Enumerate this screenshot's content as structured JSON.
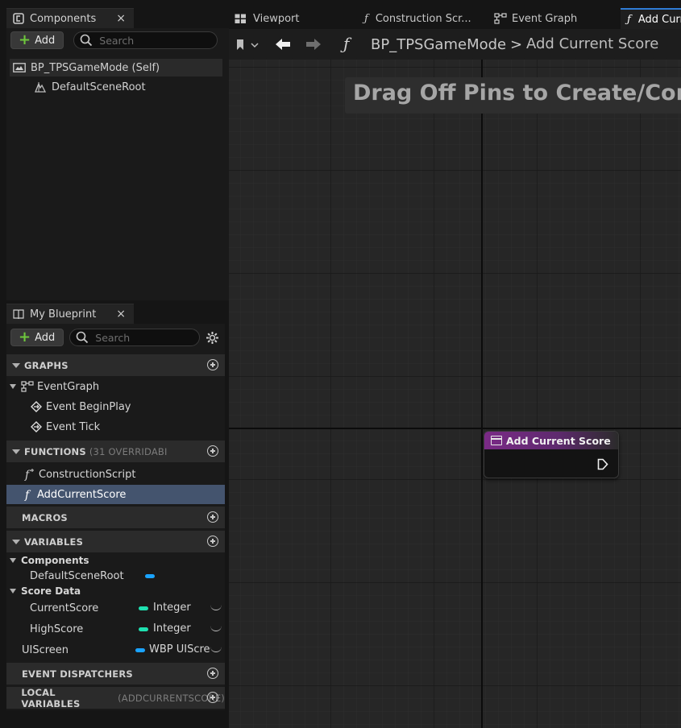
{
  "components_panel": {
    "tab_title": "Components",
    "close": "×",
    "add_label": "Add",
    "search_placeholder": "Search",
    "tree": [
      {
        "label": "BP_TPSGameMode (Self)"
      },
      {
        "label": "DefaultSceneRoot"
      }
    ]
  },
  "my_blueprint": {
    "tab_title": "My Blueprint",
    "close": "×",
    "add_label": "Add",
    "search_placeholder": "Search",
    "graphs": {
      "header": "GRAPHS",
      "event_graph": "EventGraph",
      "events": [
        "Event BeginPlay",
        "Event Tick"
      ]
    },
    "functions": {
      "header": "FUNCTIONS",
      "sub": "(31 OVERRIDABI",
      "items": [
        "ConstructionScript",
        "AddCurrentScore"
      ],
      "selected": "AddCurrentScore"
    },
    "macros": {
      "header": "MACROS"
    },
    "variables": {
      "header": "VARIABLES",
      "categories": [
        {
          "name": "Components",
          "vars": [
            {
              "name": "DefaultSceneRoot",
              "type": "",
              "color": "#1aa3ff"
            }
          ]
        },
        {
          "name": "Score Data",
          "vars": [
            {
              "name": "CurrentScore",
              "type": "Integer",
              "color": "#1fe0b0"
            },
            {
              "name": "HighScore",
              "type": "Integer",
              "color": "#1fe0b0"
            }
          ]
        }
      ],
      "loose": [
        {
          "name": "UIScreen",
          "type": "WBP UIScre",
          "color": "#1aa3ff"
        }
      ]
    },
    "event_dispatchers": {
      "header": "EVENT DISPATCHERS"
    },
    "local_variables": {
      "header": "LOCAL VARIABLES",
      "sub": "(ADDCURRENTSCORE)"
    }
  },
  "document_tabs": [
    {
      "label": "Viewport",
      "icon": "viewport-icon"
    },
    {
      "label": "Construction Scr...",
      "icon": "function-icon"
    },
    {
      "label": "Event Graph",
      "icon": "event-graph-icon"
    },
    {
      "label": "Add Curr",
      "icon": "function-icon",
      "active": true
    }
  ],
  "graph_toolbar": {
    "blueprint": "BP_TPSGameMode",
    "separator": ">",
    "function": "Add Current Score"
  },
  "graph": {
    "hint_text": "Drag Off Pins to Create/Connect",
    "node": {
      "title": "Add Current Score",
      "header_color": "#7a2a86"
    }
  },
  "colors": {
    "selection": "#44546e",
    "accent": "#2f7cd6",
    "add_plus": "#6ec73c"
  }
}
